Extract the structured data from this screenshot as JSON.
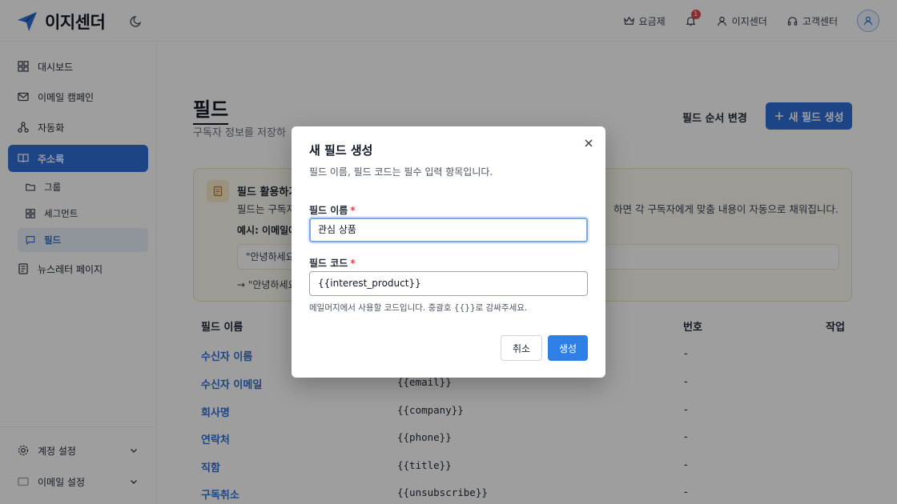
{
  "colors": {
    "brand": "#2f6fd6",
    "danger": "#e5484d",
    "link": "#2f6fd6"
  },
  "header": {
    "app_name": "이지센더",
    "pricing_label": "요금제",
    "notification_count": "1",
    "account_label": "이지센더",
    "support_label": "고객센터"
  },
  "sidebar": {
    "items": [
      {
        "label": "대시보드",
        "icon": "grid-icon"
      },
      {
        "label": "이메일 캠페인",
        "icon": "mail-icon"
      },
      {
        "label": "자동화",
        "icon": "automation-icon"
      },
      {
        "label": "주소록",
        "icon": "book-icon"
      }
    ],
    "subitems": [
      {
        "label": "그룹",
        "icon": "folder-icon"
      },
      {
        "label": "세그먼트",
        "icon": "grid-icon"
      },
      {
        "label": "필드",
        "icon": "message-icon"
      }
    ],
    "newsletter_label": "뉴스레터 페이지",
    "account_settings_label": "계정 설정",
    "email_settings_label": "이메일 설정"
  },
  "main": {
    "title": "필드",
    "subtitle": "구독자 정보를 저장하",
    "order_button": "필드 순서 변경",
    "new_button": "새 필드 생성",
    "tip": {
      "title": "필드 활용하기",
      "body_left": "필드는 구독자",
      "body_right": "하면 각 구독자에게 맞춤 내용이 자동으로 채워집니다.",
      "example_label": "예시: 이메일에",
      "example_input": "\"안녕하세요",
      "example_result": "→ \"안녕하세요"
    },
    "table": {
      "headers": {
        "name": "필드 이름",
        "number": "번호",
        "action": "작업"
      },
      "rows": [
        {
          "name": "수신자 이름",
          "code": "",
          "number": "-"
        },
        {
          "name": "수신자 이메일",
          "code": "{{email}}",
          "number": "-"
        },
        {
          "name": "회사명",
          "code": "{{company}}",
          "number": "-"
        },
        {
          "name": "연락처",
          "code": "{{phone}}",
          "number": "-"
        },
        {
          "name": "직함",
          "code": "{{title}}",
          "number": "-"
        },
        {
          "name": "구독취소",
          "code": "{{unsubscribe}}",
          "number": "-"
        }
      ]
    }
  },
  "modal": {
    "title": "새 필드 생성",
    "description": "필드 이름, 필드 코드는 필수 입력 항목입니다.",
    "name_label": "필드 이름",
    "name_value": "관심 상품",
    "code_label": "필드 코드",
    "code_value": "{{interest_product}}",
    "required_mark": "*",
    "hint": "메일머지에서 사용할 코드입니다. 중괄호 {{}}로 감싸주세요.",
    "cancel_label": "취소",
    "create_label": "생성"
  }
}
